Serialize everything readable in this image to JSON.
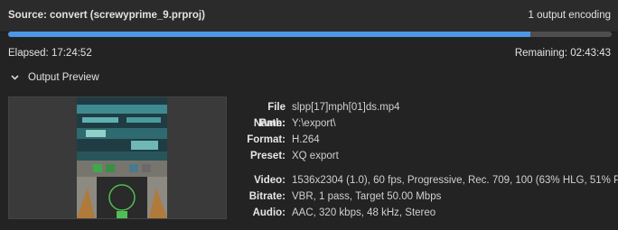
{
  "header": {
    "source": "Source: convert (screwyprime_9.prproj)",
    "output_count": "1 output encoding"
  },
  "progress": {
    "fraction": 0.866
  },
  "timing": {
    "elapsed": "Elapsed: 17:24:52",
    "remaining": "Remaining: 02:43:43"
  },
  "output_preview": {
    "label": "Output Preview"
  },
  "details": {
    "file_name": {
      "label": "File Name:",
      "value": "slpp[17]mph[01]ds.mp4"
    },
    "path": {
      "label": "Path:",
      "value": "Y:\\export\\"
    },
    "format": {
      "label": "Format:",
      "value": "H.264"
    },
    "preset": {
      "label": "Preset:",
      "value": "XQ export"
    },
    "video": {
      "label": "Video:",
      "value": "1536x2304 (1.0), 60 fps, Progressive, Rec. 709, 100 (63% HLG, 51% P..."
    },
    "bitrate": {
      "label": "Bitrate:",
      "value": "VBR, 1 pass, Target 50.00 Mbps"
    },
    "audio": {
      "label": "Audio:",
      "value": "AAC, 320 kbps, 48 kHz, Stereo"
    }
  },
  "colors": {
    "accent": "#4c97e6",
    "background": "#232323"
  }
}
